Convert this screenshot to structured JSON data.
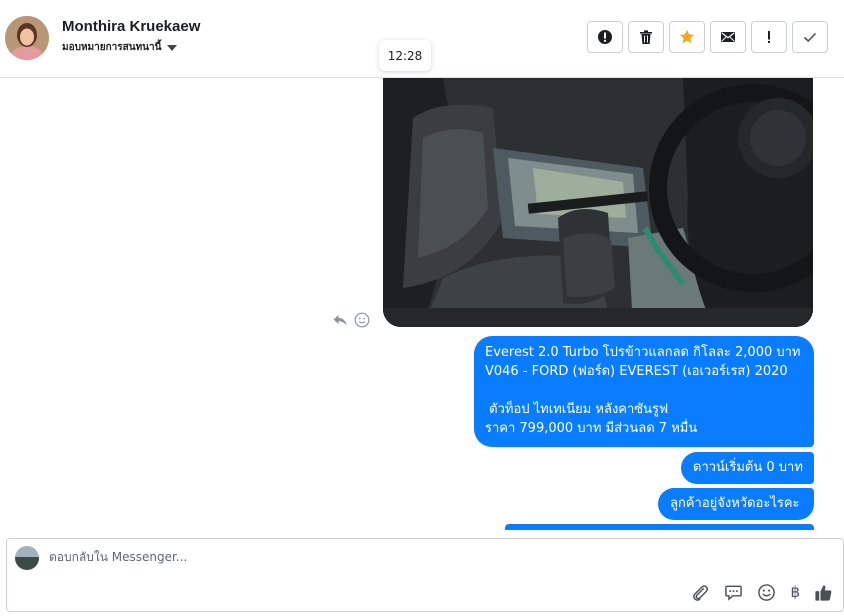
{
  "header": {
    "contact_name": "Monthira Kruekaew",
    "assign_label": "มอบหมายการสนทนานี้",
    "actions": [
      {
        "icon": "alert-circle-icon",
        "name": "mark-spam-button"
      },
      {
        "icon": "trash-icon",
        "name": "delete-button"
      },
      {
        "icon": "star-icon",
        "name": "follow-up-button"
      },
      {
        "icon": "envelope-icon",
        "name": "mark-unread-button"
      },
      {
        "icon": "exclamation-icon",
        "name": "mark-important-button"
      },
      {
        "icon": "check-icon",
        "name": "mark-done-button"
      }
    ]
  },
  "timestamp": "12:28",
  "messages": {
    "m1": {
      "line1": "Everest 2.0 Turbo โปรข้าวแลกลด กิโลละ 2,000 บาท",
      "line2": "V046 - FORD (ฟอร์ด) EVEREST (เอเวอร์เรส) 2020",
      "line3": "",
      "line4": " ตัวท็อป ไทเทเนียม หลังคาซันรูฟ",
      "line5": "ราคา 799,000 บาท มีส่วนลด 7 หมื่น"
    },
    "m2": "ดาวน์เริ่มต้น 0 บาท",
    "m3": "ลูกค้าอยู่จังหวัดอะไรคะ"
  },
  "composer": {
    "placeholder": "ตอบกลับใน Messenger...",
    "tools": [
      "paperclip-icon",
      "chat-bubble-icon",
      "smiley-icon",
      "baht-icon",
      "thumbs-up-icon"
    ],
    "currency_symbol": "฿"
  },
  "colors": {
    "bubble": "#0a7cff",
    "star": "#f5a623",
    "like": "#4b4f56"
  }
}
